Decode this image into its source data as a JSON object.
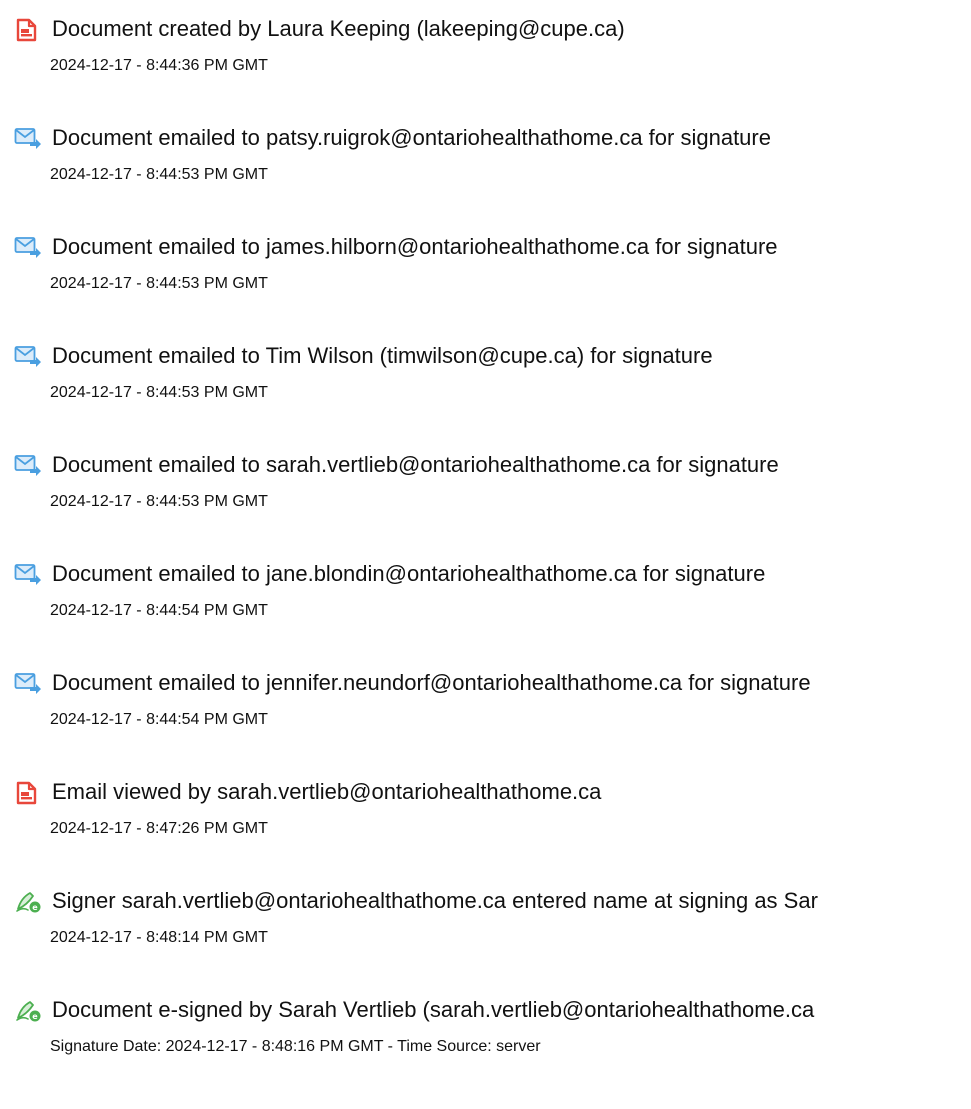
{
  "events": [
    {
      "icon": "document-created-icon",
      "title": "Document created by Laura Keeping (lakeeping@cupe.ca)",
      "timestamp": "2024-12-17 - 8:44:36 PM GMT"
    },
    {
      "icon": "email-sent-icon",
      "title": "Document emailed to patsy.ruigrok@ontariohealthathome.ca for signature",
      "timestamp": "2024-12-17 - 8:44:53 PM GMT"
    },
    {
      "icon": "email-sent-icon",
      "title": "Document emailed to james.hilborn@ontariohealthathome.ca for signature",
      "timestamp": "2024-12-17 - 8:44:53 PM GMT"
    },
    {
      "icon": "email-sent-icon",
      "title": "Document emailed to Tim Wilson (timwilson@cupe.ca) for signature",
      "timestamp": "2024-12-17 - 8:44:53 PM GMT"
    },
    {
      "icon": "email-sent-icon",
      "title": "Document emailed to sarah.vertlieb@ontariohealthathome.ca for signature",
      "timestamp": "2024-12-17 - 8:44:53 PM GMT"
    },
    {
      "icon": "email-sent-icon",
      "title": "Document emailed to jane.blondin@ontariohealthathome.ca for signature",
      "timestamp": "2024-12-17 - 8:44:54 PM GMT"
    },
    {
      "icon": "email-sent-icon",
      "title": "Document emailed to jennifer.neundorf@ontariohealthathome.ca for signature",
      "timestamp": "2024-12-17 - 8:44:54 PM GMT"
    },
    {
      "icon": "email-viewed-icon",
      "title": "Email viewed by sarah.vertlieb@ontariohealthathome.ca",
      "timestamp": "2024-12-17 - 8:47:26 PM GMT"
    },
    {
      "icon": "signer-pen-icon",
      "title": "Signer sarah.vertlieb@ontariohealthathome.ca entered name at signing as Sar",
      "timestamp": "2024-12-17 - 8:48:14 PM GMT"
    },
    {
      "icon": "signer-pen-icon",
      "title": "Document e-signed by Sarah Vertlieb (sarah.vertlieb@ontariohealthathome.ca",
      "timestamp": "Signature Date: 2024-12-17 - 8:48:16 PM GMT - Time Source: server"
    }
  ],
  "colors": {
    "document_icon": "#e8473b",
    "email_icon": "#4a9fe0",
    "pen_icon": "#4caf50",
    "text": "#111111"
  }
}
